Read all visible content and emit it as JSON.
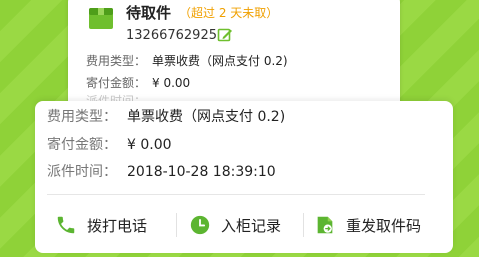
{
  "back_card": {
    "title": "待取件",
    "overdue_note": "（超过 2 天未取）",
    "phone": "13266762925",
    "rows": [
      {
        "label": "费用类型：",
        "value": "单票收费（网点支付 0.2)"
      },
      {
        "label": "寄付金额：",
        "value": "¥ 0.00"
      },
      {
        "label": "派件时间："
      }
    ]
  },
  "details": {
    "rows": [
      {
        "label": "费用类型：",
        "value": "单票收费（网点支付 0.2)"
      },
      {
        "label": "寄付金额：",
        "value": "¥ 0.00"
      },
      {
        "label": "派件时间：",
        "value": "2018-10-28 18:39:10"
      }
    ]
  },
  "actions": [
    {
      "label": "拨打电话",
      "icon": "phone-icon"
    },
    {
      "label": "入柜记录",
      "icon": "clock-icon"
    },
    {
      "label": "重发取件码",
      "icon": "resend-icon"
    }
  ],
  "colors": {
    "accent_green": "#5cb531",
    "background_green": "#8fd238",
    "note_orange": "#f0a000"
  }
}
